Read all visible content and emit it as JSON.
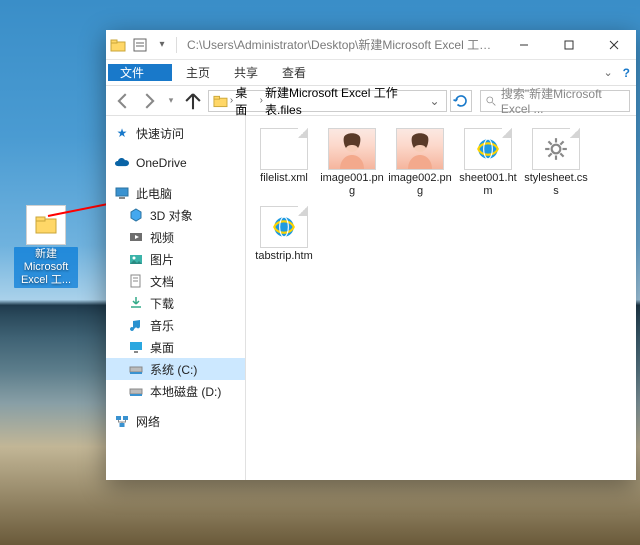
{
  "desktop": {
    "icon_label": "新建Microsoft Excel 工..."
  },
  "window": {
    "title_path": "C:\\Users\\Administrator\\Desktop\\新建Microsoft Excel 工作表.files",
    "ribbon": {
      "file": "文件",
      "home": "主页",
      "share": "共享",
      "view": "查看"
    },
    "breadcrumb": {
      "seg1": "桌面",
      "seg2": "新建Microsoft Excel 工作表.files"
    },
    "search_placeholder": "搜索\"新建Microsoft Excel ..."
  },
  "sidebar": {
    "quick_access": "快速访问",
    "onedrive": "OneDrive",
    "this_pc": "此电脑",
    "items": {
      "objects3d": "3D 对象",
      "videos": "视频",
      "pictures": "图片",
      "documents": "文档",
      "downloads": "下载",
      "music": "音乐",
      "desktop": "桌面",
      "c_drive": "系统 (C:)",
      "d_drive": "本地磁盘 (D:)"
    },
    "network": "网络"
  },
  "files": {
    "f1": "filelist.xml",
    "f2": "image001.png",
    "f3": "image002.png",
    "f4": "sheet001.htm",
    "f5": "stylesheet.css",
    "f6": "tabstrip.htm"
  }
}
